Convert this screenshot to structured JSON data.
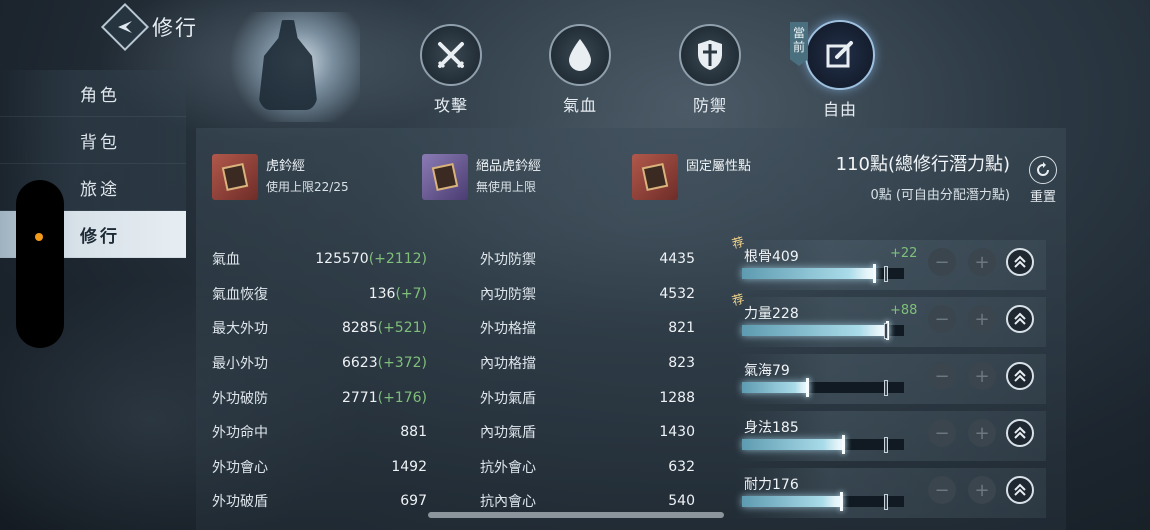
{
  "header": {
    "title": "修行"
  },
  "nav": {
    "items": [
      {
        "label": "角色"
      },
      {
        "label": "背包"
      },
      {
        "label": "旅途"
      },
      {
        "label": "修行"
      }
    ],
    "active_index": 3
  },
  "tabs": [
    {
      "label": "攻擊",
      "icon": "swords-icon"
    },
    {
      "label": "氣血",
      "icon": "drop-icon"
    },
    {
      "label": "防禦",
      "icon": "shield-icon"
    },
    {
      "label": "自由",
      "icon": "edit-icon",
      "badge": "當前"
    }
  ],
  "items": [
    {
      "name": "虎鈐經",
      "sub": "使用上限22/25",
      "rarity_color": "#b1584b"
    },
    {
      "name": "絕品虎鈐經",
      "sub": "無使用上限",
      "rarity_color": "#8b7bb5"
    },
    {
      "name": "固定屬性點",
      "sub": "",
      "rarity_color": "#b1584b"
    }
  ],
  "points": {
    "total": "110點(總修行潛力點)",
    "free": "0點 (可自由分配潛力點)",
    "reset_label": "重置"
  },
  "stats_left": [
    {
      "name": "氣血",
      "value": "125570",
      "bonus": "(+2112)"
    },
    {
      "name": "氣血恢復",
      "value": "136",
      "bonus": "(+7)"
    },
    {
      "name": "最大外功",
      "value": "8285",
      "bonus": "(+521)"
    },
    {
      "name": "最小外功",
      "value": "6623",
      "bonus": "(+372)"
    },
    {
      "name": "外功破防",
      "value": "2771",
      "bonus": "(+176)"
    },
    {
      "name": "外功命中",
      "value": "881",
      "bonus": ""
    },
    {
      "name": "外功會心",
      "value": "1492",
      "bonus": ""
    },
    {
      "name": "外功破盾",
      "value": "697",
      "bonus": ""
    }
  ],
  "stats_right": [
    {
      "name": "外功防禦",
      "value": "4435"
    },
    {
      "name": "內功防禦",
      "value": "4532"
    },
    {
      "name": "外功格擋",
      "value": "821"
    },
    {
      "name": "內功格擋",
      "value": "823"
    },
    {
      "name": "外功氣盾",
      "value": "1288"
    },
    {
      "name": "內功氣盾",
      "value": "1430"
    },
    {
      "name": "抗外會心",
      "value": "632"
    },
    {
      "name": "抗內會心",
      "value": "540"
    }
  ],
  "attributes": [
    {
      "label": "根骨409",
      "bonus": "+22",
      "recommended": "荐",
      "fill": 0.82
    },
    {
      "label": "力量228",
      "bonus": "+88",
      "recommended": "荐",
      "fill": 0.9
    },
    {
      "label": "氣海79",
      "bonus": "",
      "recommended": "",
      "fill": 0.41
    },
    {
      "label": "身法185",
      "bonus": "",
      "recommended": "",
      "fill": 0.63
    },
    {
      "label": "耐力176",
      "bonus": "",
      "recommended": "",
      "fill": 0.62
    }
  ],
  "colors": {
    "accent": "#9fc1e0",
    "bonus_green": "#7fbf7a",
    "active_nav": "#e7eef3",
    "notification_dot": "#f39a1a"
  }
}
